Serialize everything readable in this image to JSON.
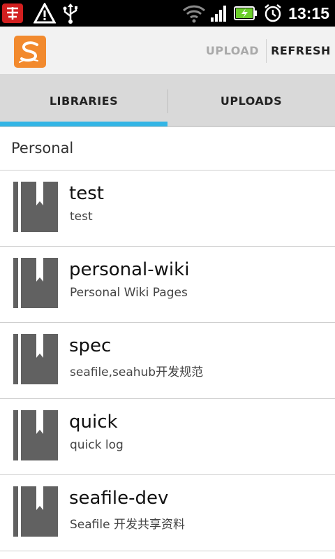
{
  "status_bar": {
    "time": "13:15",
    "icons": [
      "app-notification-icon",
      "warning-icon",
      "usb-icon",
      "wifi-icon",
      "signal-icon",
      "battery-charging-icon",
      "alarm-icon"
    ]
  },
  "action_bar": {
    "upload_label": "UPLOAD",
    "refresh_label": "REFRESH",
    "logo_letter": "S"
  },
  "tabs": [
    {
      "label": "LIBRARIES",
      "selected": true
    },
    {
      "label": "UPLOADS",
      "selected": false
    }
  ],
  "section": {
    "title": "Personal"
  },
  "libraries": [
    {
      "name": "test",
      "desc": "test"
    },
    {
      "name": "personal-wiki",
      "desc": "Personal Wiki Pages"
    },
    {
      "name": "spec",
      "desc": "seafile,seahub开发规范"
    },
    {
      "name": "quick",
      "desc": "quick log"
    },
    {
      "name": "seafile-dev",
      "desc": "Seafile 开发共享资料"
    }
  ],
  "colors": {
    "accent": "#33b5e5",
    "logo": "#f28a2e",
    "icon_gray": "#616161"
  }
}
